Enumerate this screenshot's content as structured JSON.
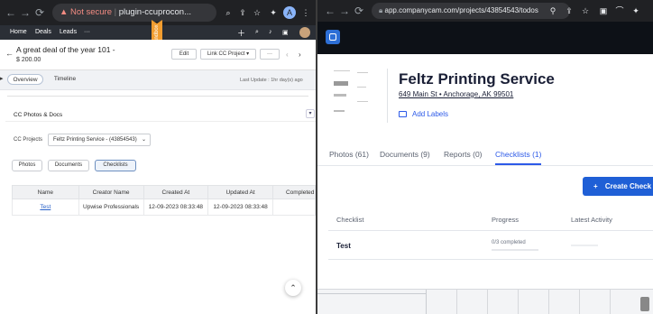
{
  "left_browser": {
    "url": "plugin-ccuprocon...",
    "security_label": "Not secure",
    "profile_initial": "A"
  },
  "crm_nav": {
    "items": [
      "Home",
      "Deals",
      "Leads",
      "···"
    ],
    "sandbox_label": "Sandbox"
  },
  "deal": {
    "title": "A great deal of the year 101 -",
    "amount": "$ 200.00",
    "edit_label": "Edit",
    "link_label": "Link CC Project",
    "more_label": "···"
  },
  "deal_tabs": {
    "overview": "Overview",
    "timeline": "Timeline",
    "last_update": "Last Update : 1hr day(s) ago"
  },
  "cc_section": {
    "title": "CC Photos & Docs",
    "projects_label": "CC Projects",
    "project_value": "Feltz Printing Service - (43854543)",
    "buttons": [
      "Photos",
      "Documents",
      "Checklists"
    ],
    "columns": [
      "Name",
      "Creator Name",
      "Created At",
      "Updated At",
      "Completed"
    ],
    "rows": [
      {
        "name": "Test",
        "creator": "Upwise Professionals",
        "created": "12-09-2023 08:33:48",
        "updated": "12-09-2023 08:33:48",
        "completed": ""
      }
    ]
  },
  "right_browser": {
    "url": "app.companycam.com/projects/43854543/todos"
  },
  "project": {
    "name": "Feltz Printing Service",
    "address": "649 Main St • Anchorage, AK 99501",
    "add_labels": "Add Labels"
  },
  "project_tabs": [
    "Photos (61)",
    "Documents (9)",
    "Reports (0)",
    "Checklists (1)"
  ],
  "create_button": "Create Check",
  "checklist_table": {
    "columns": [
      "Checklist",
      "Progress",
      "Latest Activity"
    ],
    "rows": [
      {
        "name": "Test",
        "progress": "0/3 completed"
      }
    ]
  },
  "colors": {
    "accent_blue": "#1f5fd6",
    "active_tab": "#2d5ae8",
    "crm_dark": "#2b2f36",
    "sandbox_orange": "#f29d2f"
  }
}
